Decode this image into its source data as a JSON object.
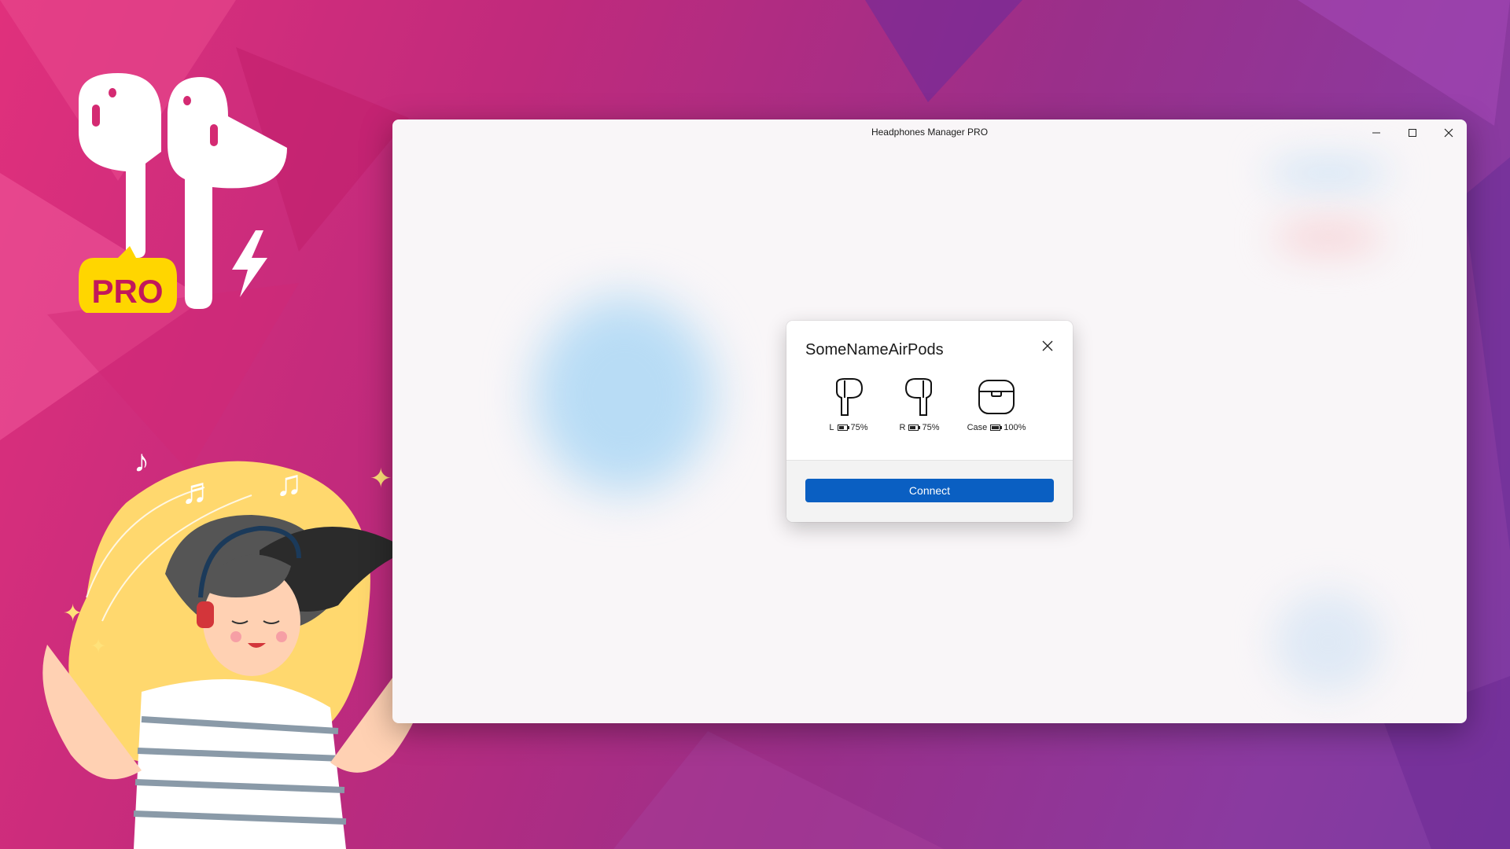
{
  "window": {
    "title": "Headphones Manager PRO",
    "controls": {
      "minimize_icon": "minimize-icon",
      "maximize_icon": "maximize-icon",
      "close_icon": "close-icon"
    }
  },
  "logo": {
    "badge_text": "PRO",
    "badge_color": "#ffd600",
    "icon": "airpods-logo-icon"
  },
  "dialog": {
    "device_name": "SomeNameAirPods",
    "close_icon": "close-icon",
    "devices": [
      {
        "label": "L",
        "battery": "75%",
        "battery_level": 0.75,
        "icon": "left-earbud-icon"
      },
      {
        "label": "R",
        "battery": "75%",
        "battery_level": 0.75,
        "icon": "right-earbud-icon"
      },
      {
        "label": "Case",
        "battery": "100%",
        "battery_level": 1.0,
        "icon": "charging-case-icon"
      }
    ],
    "connect_label": "Connect"
  },
  "colors": {
    "accent": "#0a5fc2",
    "window_bg": "#f9f6f8",
    "desktop_pink": "#e0307c",
    "desktop_purple": "#7c3aa2"
  }
}
